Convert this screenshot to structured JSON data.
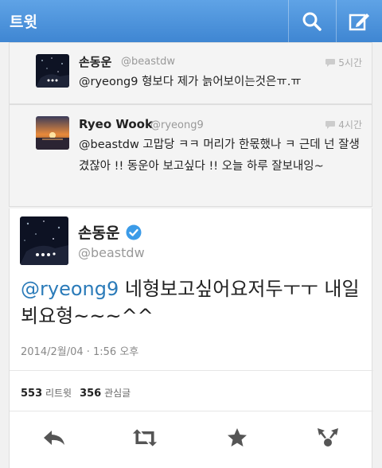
{
  "header": {
    "title": "트윗"
  },
  "replies": [
    {
      "name": "손동운",
      "handle": "@beastdw",
      "time": "5시간",
      "text": "@ryeong9 형보다 제가 늙어보이는것은ㅠ.ㅠ"
    },
    {
      "name": "Ryeo Wook",
      "handle": "@ryeong9",
      "time": "4시간",
      "text": "@beastdw 고맙당 ㅋㅋ 머리가 한몫했나 ㅋ 근데 넌 잘생겼잖아 !! 동운아 보고싶다 !! 오늘 하루 잘보내잉~"
    }
  ],
  "tweet": {
    "name": "손동운",
    "handle": "@beastdw",
    "mention": "@ryeong9",
    "text": " 네형보고싶어요저두ㅜㅜ 내일뵈요형~~~^^",
    "date": "2014/2월/04 · 1:56 오후",
    "retweets_count": "553",
    "retweets_label": "리트윗",
    "favorites_count": "356",
    "favorites_label": "관심글"
  },
  "colors": {
    "header": "#4f95dd",
    "mention": "#2b7bb9",
    "verified": "#3b9be8"
  }
}
